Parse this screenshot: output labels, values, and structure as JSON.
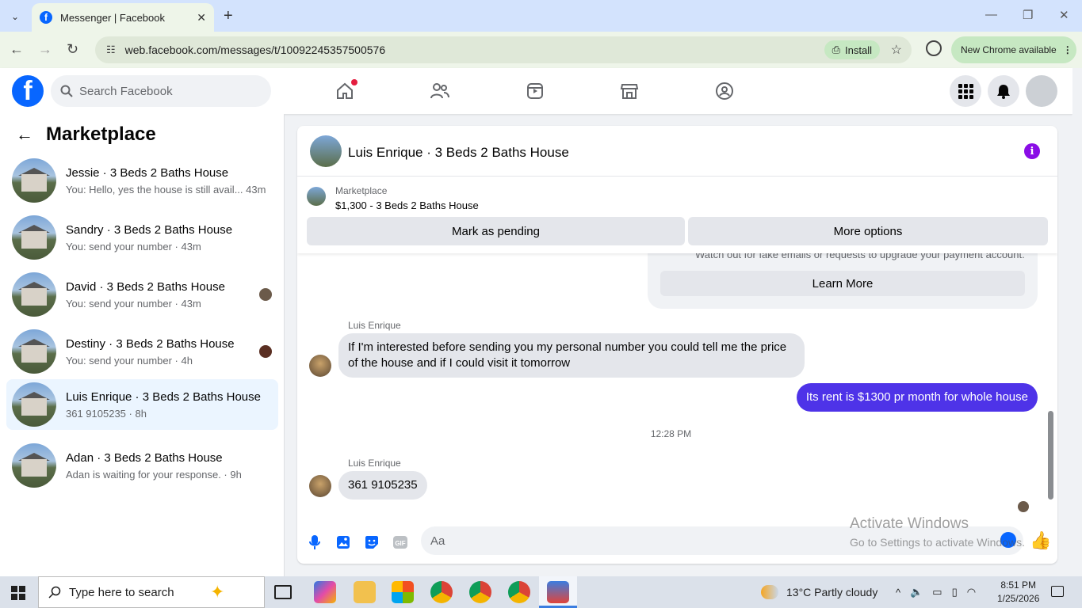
{
  "browser": {
    "tab_title": "Messenger | Facebook",
    "url": "web.facebook.com/messages/t/10092245357500576",
    "install_label": "Install",
    "update_label": "New Chrome available"
  },
  "fb": {
    "search_placeholder": "Search Facebook"
  },
  "sidebar": {
    "title": "Marketplace",
    "conversations": [
      {
        "name": "Jessie · 3 Beds 2 Baths House",
        "preview": "You: Hello, yes the house is still avail... 43m"
      },
      {
        "name": "Sandry · 3 Beds 2 Baths House",
        "preview": "You: send your number · 43m"
      },
      {
        "name": "David · 3 Beds 2 Baths House",
        "preview": "You: send your number · 43m"
      },
      {
        "name": "Destiny · 3 Beds 2 Baths House",
        "preview": "You: send your number · 4h"
      },
      {
        "name": "Luis Enrique · 3 Beds 2 Baths House",
        "preview": "361 9105235 · 8h"
      },
      {
        "name": "Adan · 3 Beds 2 Baths House",
        "preview": "Adan is waiting for your response. · 9h"
      }
    ]
  },
  "chat": {
    "title": "Luis Enrique · 3 Beds 2 Baths House",
    "marketplace_label": "Marketplace",
    "listing": "$1,300 - 3 Beds 2 Baths House",
    "mark_pending_label": "Mark as pending",
    "more_options_label": "More options",
    "warning_text": "Watch out for fake emails or requests to upgrade your payment account.",
    "learn_more_label": "Learn More",
    "messages": [
      {
        "sender": "Luis Enrique",
        "text": "If I'm interested before sending you my personal number you could tell me the price of the house and if I could visit it tomorrow"
      },
      {
        "sender": "You",
        "text": "Its rent is $1300 pr month for whole house"
      },
      {
        "timestamp": "12:28 PM"
      },
      {
        "sender": "Luis Enrique",
        "text": "361 9105235"
      }
    ],
    "composer_placeholder": "Aa"
  },
  "watermark": {
    "line1": "Activate Windows",
    "line2": "Go to Settings to activate Windows."
  },
  "taskbar": {
    "search_placeholder": "Type here to search",
    "weather": "13°C  Partly cloudy",
    "time": "8:51 PM",
    "date": "1/25/2026"
  }
}
